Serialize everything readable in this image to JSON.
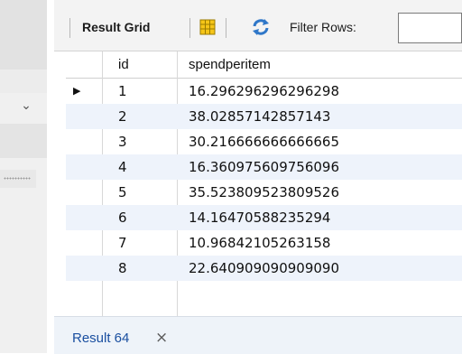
{
  "toolbar": {
    "result_grid_label": "Result Grid",
    "filter_label": "Filter Rows:",
    "filter_value": ""
  },
  "grid": {
    "columns": [
      "id",
      "spendperitem"
    ],
    "rows": [
      {
        "id": "1",
        "spendperitem": "16.296296296296298",
        "current": true
      },
      {
        "id": "2",
        "spendperitem": "38.02857142857143"
      },
      {
        "id": "3",
        "spendperitem": "30.216666666666665"
      },
      {
        "id": "4",
        "spendperitem": "16.360975609756096"
      },
      {
        "id": "5",
        "spendperitem": "35.523809523809526"
      },
      {
        "id": "6",
        "spendperitem": "14.16470588235294"
      },
      {
        "id": "7",
        "spendperitem": "10.96842105263158"
      },
      {
        "id": "8",
        "spendperitem": "22.640909090909090"
      }
    ]
  },
  "tabs": {
    "result_tab_label": "Result 64",
    "close_glyph": "×"
  },
  "icons": {
    "row_pointer": "▶",
    "chevron": "⌄"
  },
  "colors": {
    "alt_row": "#eef3fb",
    "tab_text": "#1a4fa0",
    "refresh_accent": "#2f77c8"
  }
}
